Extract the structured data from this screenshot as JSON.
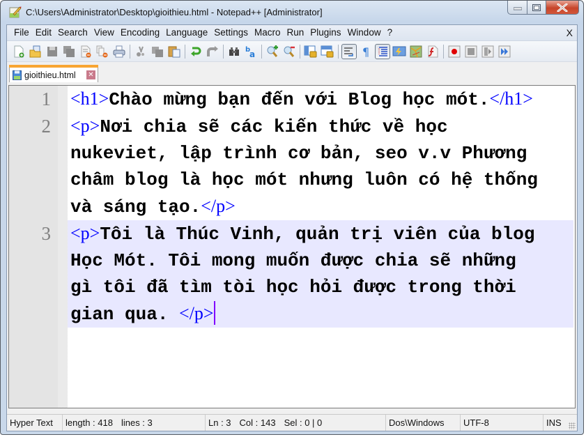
{
  "window": {
    "title": "C:\\Users\\Administrator\\Desktop\\gioithieu.html - Notepad++ [Administrator]",
    "controls": [
      "minimize",
      "maximize",
      "close"
    ]
  },
  "menu": {
    "items": [
      "File",
      "Edit",
      "Search",
      "View",
      "Encoding",
      "Language",
      "Settings",
      "Macro",
      "Run",
      "Plugins",
      "Window",
      "?"
    ],
    "close_label": "X"
  },
  "toolbar": {
    "groups": [
      [
        "new-file-icon",
        "open-file-icon",
        "save-icon",
        "save-all-icon",
        "close-file-icon",
        "close-all-icon",
        "print-icon"
      ],
      [
        "cut-icon",
        "copy-icon",
        "paste-icon"
      ],
      [
        "undo-icon",
        "redo-icon"
      ],
      [
        "find-icon",
        "replace-icon"
      ],
      [
        "zoom-in-icon",
        "zoom-out-icon"
      ],
      [
        "sync-vertical-icon",
        "sync-horizontal-icon"
      ],
      [
        "word-wrap-icon",
        "show-all-chars-icon",
        "indent-guide-icon",
        "user-language-icon",
        "document-map-icon",
        "function-list-icon"
      ],
      [
        "record-macro-icon",
        "stop-macro-icon",
        "play-macro-icon",
        "run-macro-multiple-icon"
      ]
    ],
    "pressed": [
      "word-wrap-icon",
      "indent-guide-icon"
    ],
    "accent_record": "#e00000"
  },
  "tabs": [
    {
      "label": "gioithieu.html",
      "active": true,
      "accent": "#f8a532"
    }
  ],
  "editor": {
    "current_line": 3,
    "lines": [
      {
        "number": "1",
        "segments": [
          {
            "type": "tag",
            "text": "<h1>"
          },
          {
            "type": "text",
            "text": "Chào mừng bạn đến với Blog học mót."
          },
          {
            "type": "tag",
            "text": "</h1>"
          }
        ]
      },
      {
        "number": "2",
        "segments": [
          {
            "type": "tag",
            "text": "<p>"
          },
          {
            "type": "text",
            "text": "Nơi chia sẽ các kiến thức về học nukeviet, lập trình cơ bản, seo v.v Phương châm blog là học mót nhưng luôn có hệ thống và sáng tạo."
          },
          {
            "type": "tag",
            "text": "</p>"
          }
        ]
      },
      {
        "number": "3",
        "segments": [
          {
            "type": "tag",
            "text": "<p>"
          },
          {
            "type": "text",
            "text": "Tôi là Thúc Vinh, quản trị viên của blog Học Mót. Tôi mong muốn được chia sẽ những gì tôi đã tìm tòi học hỏi được trong thời gian qua. "
          },
          {
            "type": "tag",
            "text": "</p>"
          }
        ]
      }
    ],
    "colors": {
      "tag": "#0000ff",
      "current_line_bg": "#e8e8ff",
      "caret": "#8000ff"
    }
  },
  "status": {
    "language": "Hyper Text",
    "length": "length : 418",
    "lines": "lines : 3",
    "ln": "Ln : 3",
    "col": "Col : 143",
    "sel": "Sel : 0 | 0",
    "eol": "Dos\\Windows",
    "encoding": "UTF-8",
    "mode": "INS"
  }
}
